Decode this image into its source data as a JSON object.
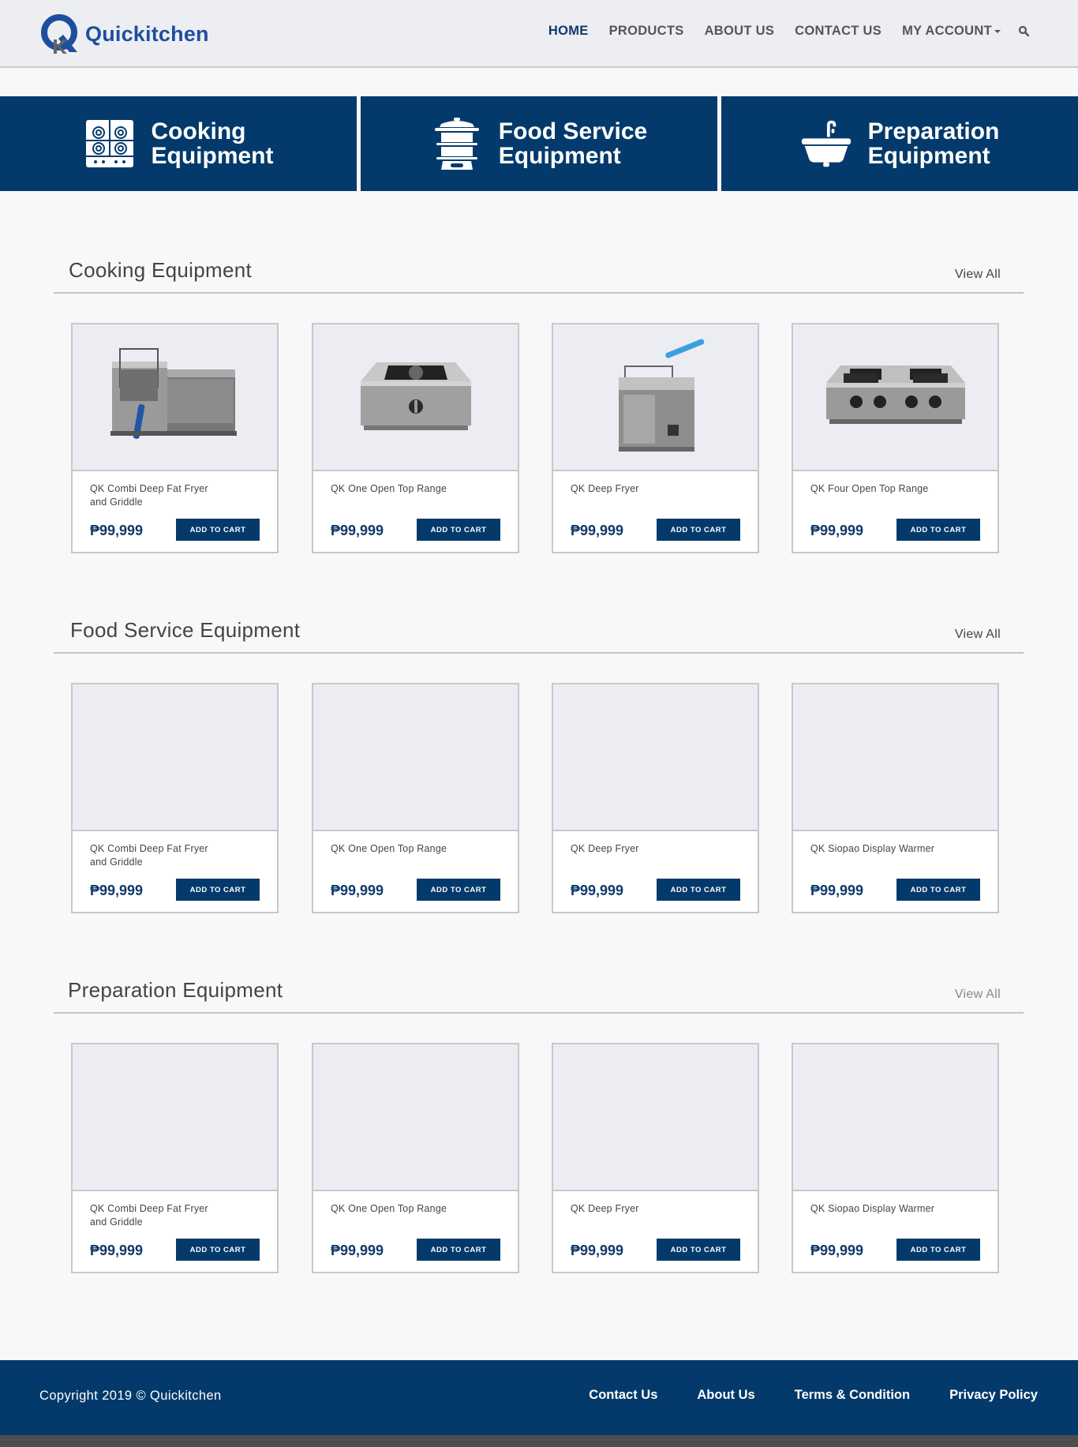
{
  "header": {
    "brand": "Quickitchen",
    "nav": [
      {
        "label": "HOME",
        "active": true
      },
      {
        "label": "PRODUCTS",
        "active": false
      },
      {
        "label": "ABOUT US",
        "active": false
      },
      {
        "label": "CONTACT US",
        "active": false
      },
      {
        "label": "MY ACCOUNT",
        "active": false
      }
    ],
    "search_icon": "search-icon"
  },
  "banners": [
    {
      "line1": "Cooking",
      "line2": "Equipment",
      "icon": "stove-icon"
    },
    {
      "line1": "Food Service",
      "line2": "Equipment",
      "icon": "steamer-icon"
    },
    {
      "line1": "Preparation",
      "line2": "Equipment",
      "icon": "sink-icon"
    }
  ],
  "sections": [
    {
      "title": "Cooking Equipment",
      "view_all": "View All",
      "products": [
        {
          "name": "QK Combi Deep Fat Fryer and Griddle",
          "price": "₱99,999",
          "button": "ADD TO CART",
          "image": "fryer-griddle"
        },
        {
          "name": "QK One Open Top Range",
          "price": "₱99,999",
          "button": "ADD TO CART",
          "image": "one-burner"
        },
        {
          "name": "QK Deep Fryer",
          "price": "₱99,999",
          "button": "ADD TO CART",
          "image": "deep-fryer"
        },
        {
          "name": "QK Four Open Top Range",
          "price": "₱99,999",
          "button": "ADD TO CART",
          "image": "four-burner"
        }
      ]
    },
    {
      "title": "Food Service Equipment",
      "view_all": "View All",
      "products": [
        {
          "name": "QK Combi Deep Fat Fryer and Griddle",
          "price": "₱99,999",
          "button": "ADD TO CART",
          "image": ""
        },
        {
          "name": "QK One Open Top Range",
          "price": "₱99,999",
          "button": "ADD TO CART",
          "image": ""
        },
        {
          "name": "QK Deep Fryer",
          "price": "₱99,999",
          "button": "ADD TO CART",
          "image": ""
        },
        {
          "name": "QK Siopao Display Warmer",
          "price": "₱99,999",
          "button": "ADD TO CART",
          "image": ""
        }
      ]
    },
    {
      "title": "Preparation Equipment",
      "view_all": "View All",
      "products": [
        {
          "name": "QK Combi Deep Fat Fryer and Griddle",
          "price": "₱99,999",
          "button": "ADD TO CART",
          "image": ""
        },
        {
          "name": "QK One Open Top Range",
          "price": "₱99,999",
          "button": "ADD TO CART",
          "image": ""
        },
        {
          "name": "QK Deep Fryer",
          "price": "₱99,999",
          "button": "ADD TO CART",
          "image": ""
        },
        {
          "name": "QK Siopao Display Warmer",
          "price": "₱99,999",
          "button": "ADD TO CART",
          "image": ""
        }
      ]
    }
  ],
  "footer": {
    "copyright": "Copyright 2019 © Quickitchen",
    "links": [
      "Contact Us",
      "About Us",
      "Terms & Condition",
      "Privacy Policy"
    ]
  },
  "colors": {
    "primary": "#033a6b",
    "brand": "#1e4f9e",
    "background": "#f8f8f8",
    "card_image_bg": "#ecedf2"
  }
}
